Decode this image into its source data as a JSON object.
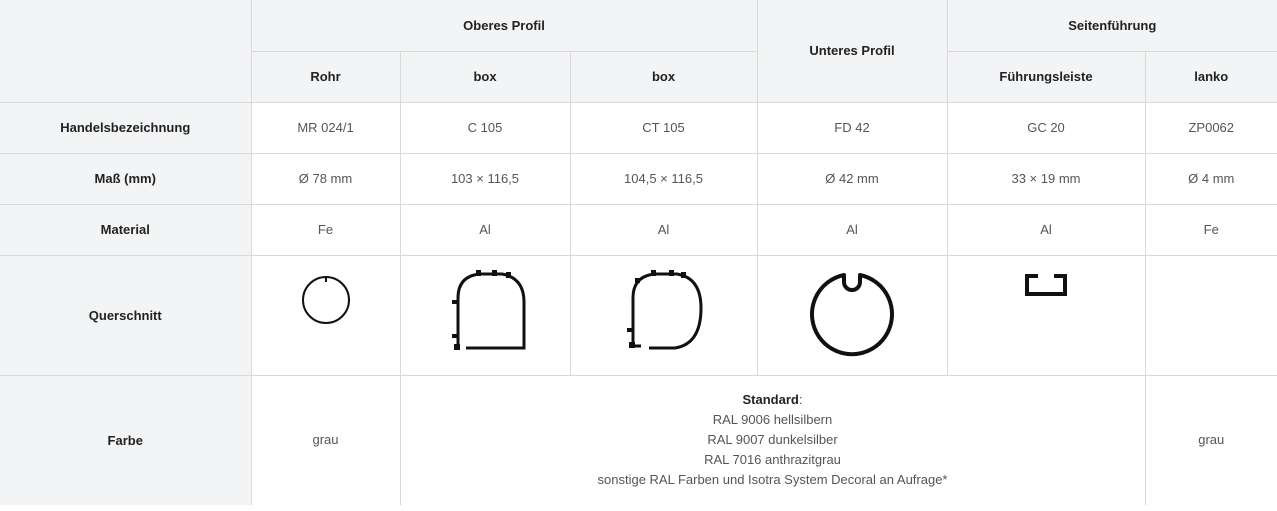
{
  "header": {
    "oberes_profil": "Oberes Profil",
    "unteres_profil": "Unteres Profil",
    "seitenfuehrung": "Seitenführung",
    "sub": [
      "Rohr",
      "box",
      "box",
      "Führungsleiste",
      "lanko"
    ]
  },
  "rows": {
    "handelsbezeichnung": {
      "label": "Handelsbezeichnung",
      "values": [
        "MR 024/1",
        "C 105",
        "CT 105",
        "FD 42",
        "GC 20",
        "ZP0062"
      ]
    },
    "mass": {
      "label": "Maß (mm)",
      "values": [
        "Ø 78 mm",
        "103 × 116,5",
        "104,5 × 116,5",
        "Ø 42 mm",
        "33 × 19 mm",
        "Ø 4 mm"
      ]
    },
    "material": {
      "label": "Material",
      "values": [
        "Fe",
        "Al",
        "Al",
        "Al",
        "Al",
        "Fe"
      ]
    },
    "querschnitt": {
      "label": "Querschnitt",
      "icons": [
        "tube-cross-section-icon",
        "box-cross-section-icon",
        "box-cross-section-icon",
        "round-profile-cross-section-icon",
        "guide-rail-cross-section-icon"
      ]
    },
    "farbe": {
      "label": "Farbe",
      "first": "grau",
      "standard_label": "Standard",
      "standard_colon": ":",
      "standard_lines": [
        "RAL 9006 hellsilbern",
        "RAL 9007 dunkelsilber",
        "RAL 7016 anthrazitgrau",
        "sonstige RAL Farben und Isotra System Decoral an Aufrage*"
      ],
      "last": "grau"
    }
  },
  "colors": {
    "header_bg": "#f3f4f5",
    "border": "#d9d9d9",
    "text": "#555555"
  }
}
